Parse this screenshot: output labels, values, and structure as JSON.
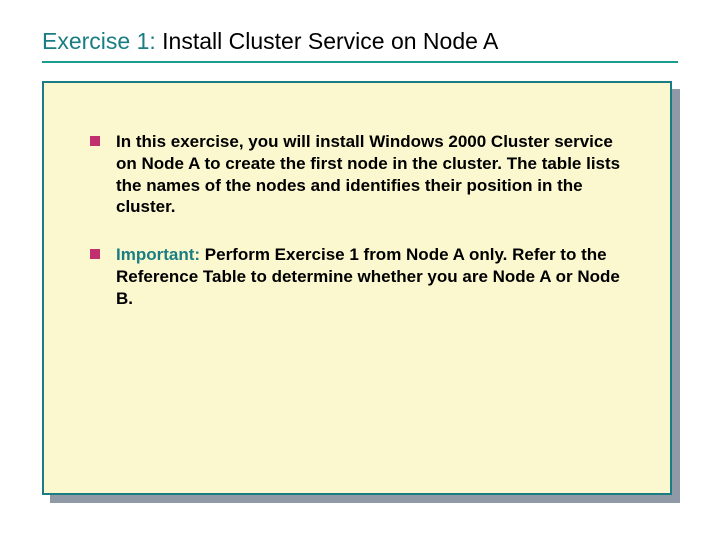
{
  "title": {
    "lead": "Exercise 1:",
    "rest": " Install Cluster Service on Node A"
  },
  "bullets": [
    {
      "emph": "",
      "body": "In this exercise, you will install Windows 2000 Cluster service on Node A to create the first node in the cluster. The table lists the names of the nodes and identifies their position in the cluster."
    },
    {
      "emph": "Important:",
      "body": " Perform Exercise 1 from Node A only. Refer to the Reference Table to determine whether you are Node A or Node B."
    }
  ]
}
